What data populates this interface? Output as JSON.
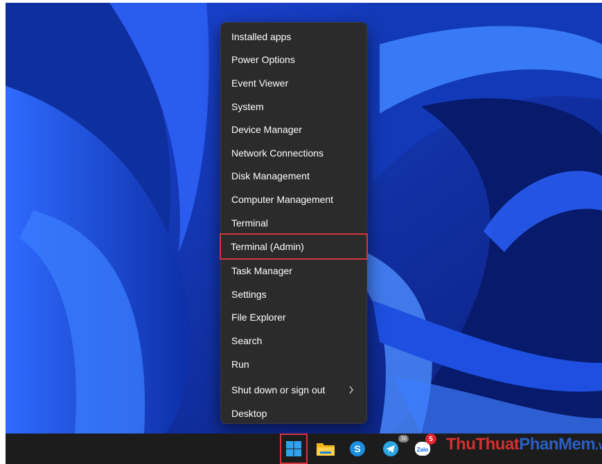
{
  "context_menu": {
    "items": [
      {
        "label": "Installed apps"
      },
      {
        "label": "Power Options"
      },
      {
        "label": "Event Viewer"
      },
      {
        "label": "System"
      },
      {
        "label": "Device Manager"
      },
      {
        "label": "Network Connections"
      },
      {
        "label": "Disk Management"
      },
      {
        "label": "Computer Management"
      },
      {
        "label": "Terminal"
      },
      {
        "label": "Terminal (Admin)",
        "highlighted": true
      },
      {
        "label": "Task Manager"
      },
      {
        "label": "Settings"
      },
      {
        "label": "File Explorer"
      },
      {
        "label": "Search"
      },
      {
        "label": "Run"
      },
      {
        "label": "Shut down or sign out",
        "submenu": true
      },
      {
        "label": "Desktop"
      }
    ]
  },
  "taskbar": {
    "icons": [
      "windows-start-icon",
      "file-explorer-icon",
      "skype-icon",
      "telegram-icon",
      "zalo-icon"
    ],
    "telegram_badge": "36",
    "zalo_badge": "5",
    "zalo_label": "Zalo"
  },
  "watermark": {
    "part1": "Thu",
    "part2": "Thuat",
    "part3": "PhanMem",
    "part4": ".vn"
  },
  "colors": {
    "highlight": "#d6343e",
    "menu_bg": "#2b2b2b",
    "taskbar_bg": "#1c1c1c"
  }
}
